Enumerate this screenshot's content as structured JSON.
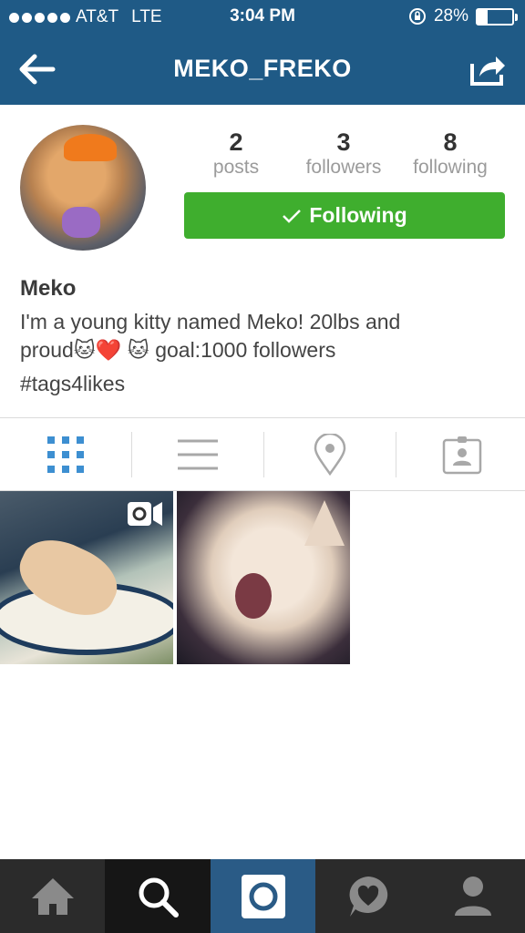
{
  "status_bar": {
    "carrier": "AT&T",
    "network": "LTE",
    "time": "3:04 PM",
    "battery": "28%",
    "battery_level": 0.28
  },
  "nav": {
    "title": "MEKO_FREKO",
    "back_icon": "back-arrow-icon",
    "share_icon": "share-icon"
  },
  "stats": [
    {
      "num": "2",
      "label": "posts"
    },
    {
      "num": "3",
      "label": "followers"
    },
    {
      "num": "8",
      "label": "following"
    }
  ],
  "follow_button": {
    "label": "Following"
  },
  "bio": {
    "name": "Meko",
    "line1": "I'm a young kitty named Meko! 20lbs and",
    "line2": "proud🐱❤️ 🐱 goal:1000 followers",
    "tags": "#tags4likes"
  },
  "tabs": [
    "grid-view-icon",
    "list-view-icon",
    "location-icon",
    "tagged-photos-icon"
  ],
  "bottom_bar": [
    "home-icon",
    "search-icon",
    "camera-icon",
    "activity-icon",
    "profile-icon"
  ],
  "colors": {
    "header": "#1f5a86",
    "follow_green": "#3fae2e",
    "active_tab_blue": "#3d8fd1",
    "bottom_bar": "#2b2b2b",
    "camera_tab": "#2a5b86"
  }
}
